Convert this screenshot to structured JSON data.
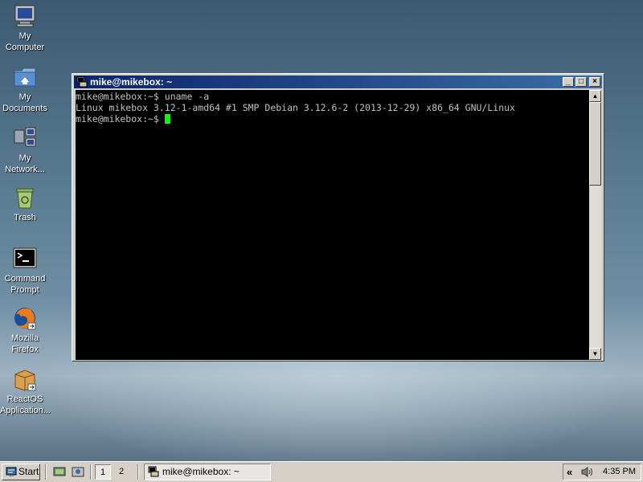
{
  "desktop": {
    "icons": [
      {
        "name": "my-computer",
        "label": "My\nComputer"
      },
      {
        "name": "my-documents",
        "label": "My\nDocuments"
      },
      {
        "name": "my-network",
        "label": "My\nNetwork..."
      },
      {
        "name": "trash",
        "label": "Trash"
      },
      {
        "name": "command-prompt",
        "label": "Command\nPrompt"
      },
      {
        "name": "mozilla-firefox",
        "label": "Mozilla\nFirefox"
      },
      {
        "name": "reactos-applications",
        "label": "ReactOS\nApplication..."
      }
    ]
  },
  "terminal": {
    "title": "mike@mikebox: ~",
    "lines": [
      "mike@mikebox:~$ uname -a",
      "Linux mikebox 3.12-1-amd64 #1 SMP Debian 3.12.6-2 (2013-12-29) x86_64 GNU/Linux",
      "mike@mikebox:~$ "
    ],
    "minimize_label": "_",
    "maximize_label": "□",
    "close_label": "×"
  },
  "taskbar": {
    "start_label": "Start",
    "workspaces": [
      "1",
      "2"
    ],
    "active_workspace": "1",
    "task_label": "mike@mikebox: ~",
    "tray_chevron": "«",
    "clock": "4:35 PM"
  },
  "colors": {
    "titlebar_start": "#0a246a",
    "titlebar_end": "#3a6ea5",
    "terminal_bg": "#000000",
    "terminal_fg": "#c0c0c0",
    "cursor": "#00ff00"
  }
}
